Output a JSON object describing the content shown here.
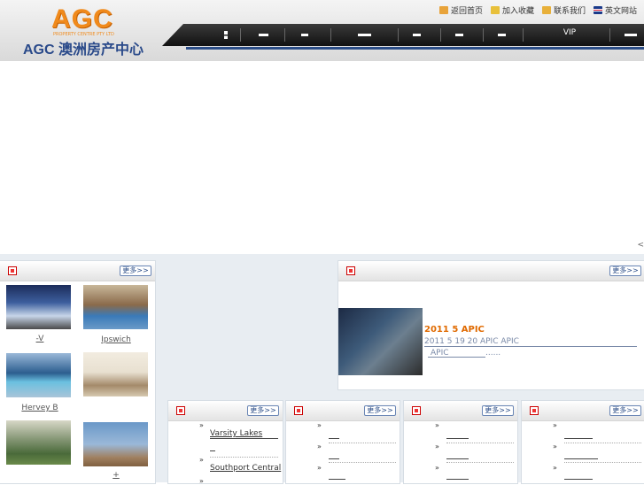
{
  "header": {
    "logo_text": "AGC",
    "logo_sub": "PROPERTY CENTRE PTY LTD",
    "logo_name": "AGC 澳洲房产中心",
    "toplinks": [
      {
        "label": "返回首页",
        "icon": "home-icon",
        "color": "#e8a33a"
      },
      {
        "label": "加入收藏",
        "icon": "favorite-icon",
        "color": "#e8c03a"
      },
      {
        "label": "联系我们",
        "icon": "mail-icon",
        "color": "#e8b03a"
      },
      {
        "label": "英文网站",
        "icon": "uk-flag-icon",
        "color": "#c8102e"
      }
    ],
    "nav_vip": "VIP"
  },
  "banner": {
    "arrow": "<"
  },
  "photos": {
    "more": "更多>>",
    "items": [
      {
        "label": "-V",
        "color_a": "#3d5f9e",
        "color_b": "#c7d5e8"
      },
      {
        "label": "Ipswich",
        "color_a": "#8a6a4a",
        "color_b": "#3a7ab8"
      },
      {
        "label": "Hervey B",
        "color_a": "#2c5e8f",
        "color_b": "#a9c4d8"
      },
      {
        "label": "",
        "color_a": "#e8e0d0",
        "color_b": "#a48a6a"
      },
      {
        "label": "",
        "color_a": "#4a6a3a",
        "color_b": "#d8d8c8"
      },
      {
        "label": "+",
        "color_a": "#6a98c8",
        "color_b": "#a08060"
      }
    ]
  },
  "news": {
    "more": "更多>>",
    "title": "2011  5  APIC",
    "text1": "2011 5 19  20  APIC                    APIC",
    "text2": "APIC",
    "more_link": "......"
  },
  "columns": [
    {
      "more": "更多>>",
      "items": [
        "Varsity Lakes",
        "",
        "Southport Central"
      ]
    },
    {
      "more": "更多>>",
      "items": [
        "",
        "",
        ""
      ]
    },
    {
      "more": "更多>>",
      "items": [
        "",
        "",
        ""
      ]
    },
    {
      "more": "更多>>",
      "items": [
        "",
        "",
        ""
      ]
    }
  ]
}
